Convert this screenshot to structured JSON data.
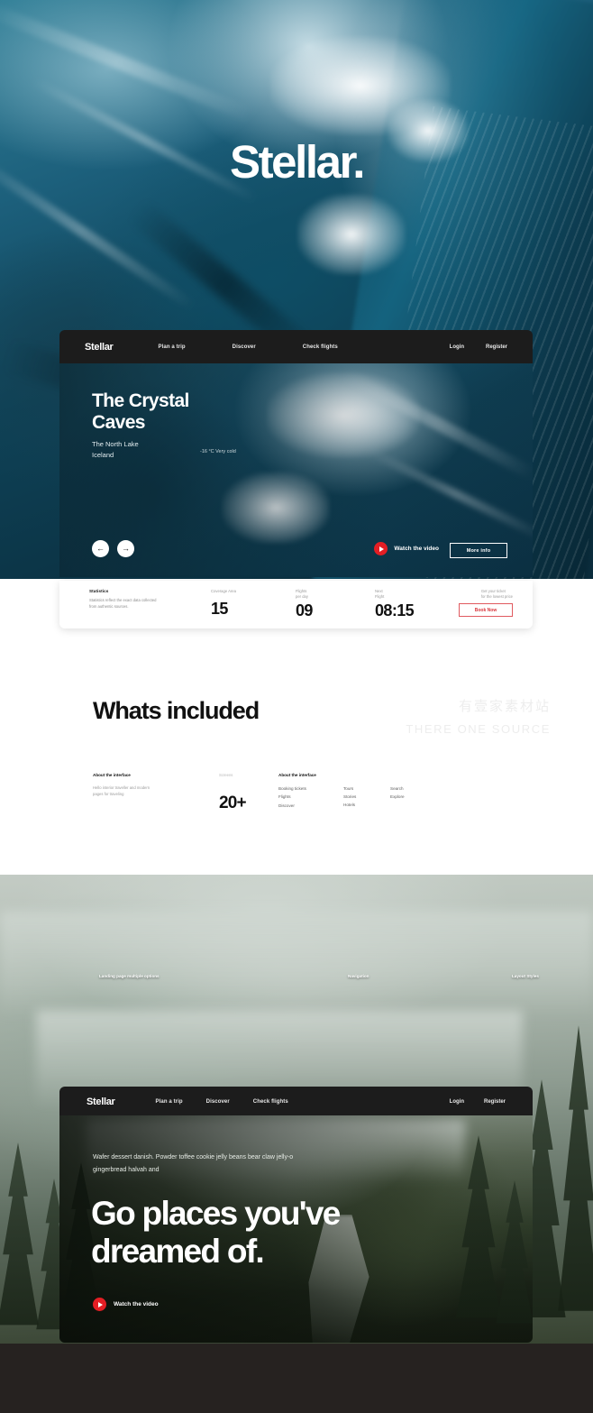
{
  "brand": {
    "wordmark": "Stellar."
  },
  "nav_primary": {
    "logo": "Stellar",
    "links": [
      "Plan a trip",
      "Discover",
      "Check flights"
    ],
    "auth": [
      "Login",
      "Register"
    ]
  },
  "nav_secondary": {
    "logo": "Stellar",
    "links": [
      "Plan a trip",
      "Discover",
      "Check flights"
    ],
    "auth": [
      "Login",
      "Register"
    ]
  },
  "hero_ice": {
    "title_line1": "The Crystal",
    "title_line2": "Caves",
    "location_line1": "The North Lake",
    "location_line2": "Iceland",
    "temperature": "-16 °C Very cold",
    "prev_icon": "arrow-left-icon",
    "next_icon": "arrow-right-icon",
    "watch_label": "Watch the video",
    "more_info_label": "More info"
  },
  "stats": {
    "caption": "Statistics",
    "description": "Statistics reflect the exact data collected from authentic sources.",
    "items": [
      {
        "label_line1": "Coverage Area",
        "label_line2": "",
        "value": "15"
      },
      {
        "label_line1": "Flights",
        "label_line2": "per day",
        "value": "09"
      },
      {
        "label_line1": "Next",
        "label_line2": "Flight",
        "value": "08:15"
      }
    ],
    "cta_note_line1": "Get your ticket",
    "cta_note_line2": "for the lowest price",
    "cta_label": "Book Now"
  },
  "included": {
    "title": "Whats included",
    "watermark_cn": "有壹家素材站",
    "watermark_en": "THERE ONE SOURCE",
    "left": {
      "head": "About the interface",
      "sub": "Hello interior traveller and modern pages for traveling"
    },
    "middle": {
      "tag": "Screens",
      "value": "20+"
    },
    "right": {
      "head": "About the interface",
      "col1": [
        "Booking tickets",
        "Flights",
        "Discover"
      ],
      "col2": [
        "Tours",
        "Stories",
        "Hotels"
      ],
      "col3": [
        "Search",
        "Explore"
      ]
    }
  },
  "forest_tags": [
    "Landing page multiple options",
    "Navigation",
    "Layout Styles"
  ],
  "hero_forest": {
    "kicker": "Wafer dessert danish. Powder toffee cookie jelly beans bear claw jelly-o gingerbread halvah and",
    "head_line1": "Go places you've",
    "head_line2": "dreamed of.",
    "watch_label": "Watch the video"
  }
}
